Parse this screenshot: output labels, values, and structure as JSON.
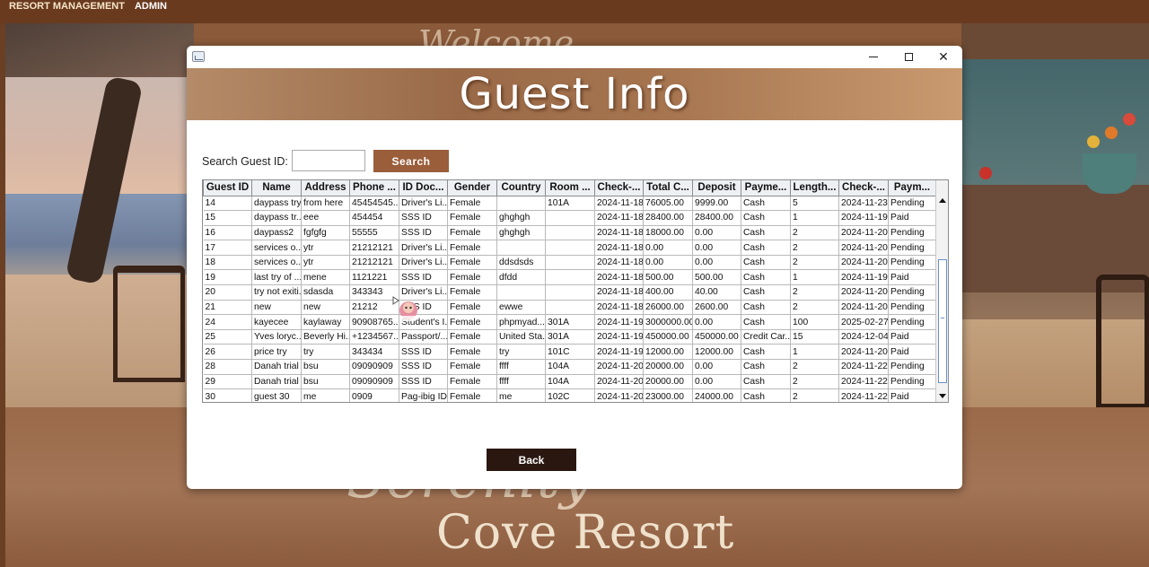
{
  "menubar": {
    "item1": "RESORT MANAGEMENT",
    "item2": "ADMIN"
  },
  "background": {
    "script": "Serenity",
    "resort": "Cove Resort",
    "welcome": "Welcome"
  },
  "window": {
    "minimize": "minimize",
    "maximize": "maximize",
    "close": "close"
  },
  "banner": {
    "title": "Guest Info"
  },
  "search": {
    "label": "Search Guest ID:",
    "value": "",
    "button": "Search"
  },
  "table": {
    "columns": [
      "Guest ID",
      "Name",
      "Address",
      "Phone ...",
      "ID Doc...",
      "Gender",
      "Country",
      "Room ...",
      "Check-...",
      "Total C...",
      "Deposit",
      "Payme...",
      "Length...",
      "Check-...",
      "Paym..."
    ],
    "rows": [
      [
        "14",
        "daypass try",
        "from here",
        "45454545...",
        "Driver's Li...",
        "Female",
        "",
        "101A",
        "2024-11-18",
        "76005.00",
        "9999.00",
        "Cash",
        "5",
        "2024-11-23",
        "Pending"
      ],
      [
        "15",
        "daypass tr...",
        "eee",
        "454454",
        "SSS ID",
        "Female",
        "ghghgh",
        "",
        "2024-11-18",
        "28400.00",
        "28400.00",
        "Cash",
        "1",
        "2024-11-19",
        "Paid"
      ],
      [
        "16",
        "daypass2",
        "fgfgfg",
        "55555",
        "SSS ID",
        "Female",
        "ghghgh",
        "",
        "2024-11-18",
        "18000.00",
        "0.00",
        "Cash",
        "2",
        "2024-11-20",
        "Pending"
      ],
      [
        "17",
        "services o...",
        "ytr",
        "21212121",
        "Driver's Li...",
        "Female",
        "",
        "",
        "2024-11-18",
        "0.00",
        "0.00",
        "Cash",
        "2",
        "2024-11-20",
        "Pending"
      ],
      [
        "18",
        "services o...",
        "ytr",
        "21212121",
        "Driver's Li...",
        "Female",
        "ddsdsds",
        "",
        "2024-11-18",
        "0.00",
        "0.00",
        "Cash",
        "2",
        "2024-11-20",
        "Pending"
      ],
      [
        "19",
        "last try of ...",
        "mene",
        "1121221",
        "SSS ID",
        "Female",
        "dfdd",
        "",
        "2024-11-18",
        "500.00",
        "500.00",
        "Cash",
        "1",
        "2024-11-19",
        "Paid"
      ],
      [
        "20",
        "try not exiti...",
        "sdasda",
        "343343",
        "Driver's Li...",
        "Female",
        "",
        "",
        "2024-11-18",
        "400.00",
        "40.00",
        "Cash",
        "2",
        "2024-11-20",
        "Pending"
      ],
      [
        "21",
        "new",
        "new",
        "21212",
        "SSS ID",
        "Female",
        "ewwe",
        "",
        "2024-11-18",
        "26000.00",
        "2600.00",
        "Cash",
        "2",
        "2024-11-20",
        "Pending"
      ],
      [
        "24",
        "kayecee",
        "kaylaway",
        "90908765...",
        "Student's I...",
        "Female",
        "phpmyad...",
        "301A",
        "2024-11-19",
        "3000000.00",
        "0.00",
        "Cash",
        "100",
        "2025-02-27",
        "Pending"
      ],
      [
        "25",
        "Yves loryc...",
        "Beverly Hi...",
        "+1234567...",
        "Passport/...",
        "Female",
        "United Sta...",
        "301A",
        "2024-11-19",
        "450000.00",
        "450000.00",
        "Credit Car...",
        "15",
        "2024-12-04",
        "Paid"
      ],
      [
        "26",
        "price try",
        "try",
        "343434",
        "SSS ID",
        "Female",
        "try",
        "101C",
        "2024-11-19",
        "12000.00",
        "12000.00",
        "Cash",
        "1",
        "2024-11-20",
        "Paid"
      ],
      [
        "28",
        "Danah trial",
        "bsu",
        "09090909",
        "SSS ID",
        "Female",
        "ffff",
        "104A",
        "2024-11-20",
        "20000.00",
        "0.00",
        "Cash",
        "2",
        "2024-11-22",
        "Pending"
      ],
      [
        "29",
        "Danah trial",
        "bsu",
        "09090909",
        "SSS ID",
        "Female",
        "ffff",
        "104A",
        "2024-11-20",
        "20000.00",
        "0.00",
        "Cash",
        "2",
        "2024-11-22",
        "Pending"
      ],
      [
        "30",
        "guest 30",
        "me",
        "0909",
        "Pag-ibig ID",
        "Female",
        "me",
        "102C",
        "2024-11-20",
        "23000.00",
        "24000.00",
        "Cash",
        "2",
        "2024-11-22",
        "Paid"
      ]
    ]
  },
  "footer": {
    "back": "Back"
  },
  "colors": {
    "accent": "#9a5e3a",
    "dark": "#2a1810",
    "menubar": "#6a3a1f"
  }
}
